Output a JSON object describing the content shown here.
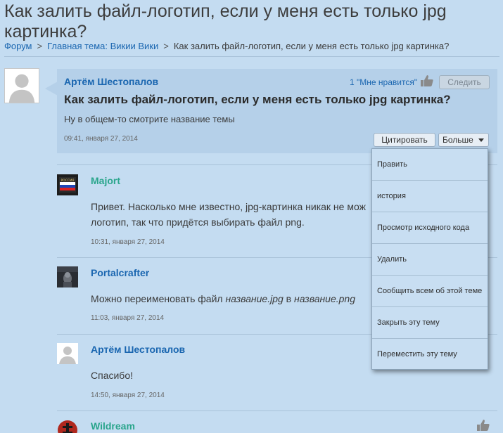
{
  "page": {
    "title": "Как залить файл-логотип, если у меня есть только jpg картинка?"
  },
  "breadcrumb": {
    "items": [
      "Форум",
      "Главная тема: Викии Вики",
      "Как залить файл-логотип, если у меня есть только jpg картинка?"
    ],
    "separator": ">"
  },
  "op": {
    "author": "Артём Шестопалов",
    "likes": "1 \"Мне нравится\"",
    "follow_label": "Следить",
    "title": "Как залить файл-логотип, если у меня есть только jpg картинка?",
    "body": "Ну в общем-то смотрите название темы",
    "time": "09:41, января 27, 2014",
    "quote_label": "Цитировать",
    "more_label": "Больше"
  },
  "replies": [
    {
      "author": "Majort",
      "body": "Привет. Насколько мне известно, jpg-картинка никак не мож логотип, так что придётся выбирать файл png.",
      "body_line1": "Привет. Насколько мне известно, jpg-картинка никак не мож",
      "body_line2": "логотип, так что придётся выбирать файл png.",
      "time": "10:31, января 27, 2014",
      "avatar_text": "РОССИЯ"
    },
    {
      "author": "Portalcrafter",
      "body_prefix": "Можно переименовать файл ",
      "body_em1": "название.jpg",
      "body_mid": " в ",
      "body_em2": "название.png",
      "time": "11:03, января 27, 2014"
    },
    {
      "author": "Артём Шестопалов",
      "body": "Спасибо!",
      "time": "14:50, января 27, 2014"
    },
    {
      "author": "Wildream"
    }
  ],
  "dropdown": {
    "items": [
      "Править",
      "история",
      "Просмотр исходного кода",
      "Удалить",
      "Сообщить всем об этой теме",
      "Закрыть эту тему",
      "Переместить эту тему"
    ]
  },
  "colors": {
    "background": "#c4dcf1",
    "op_box": "#b5d0e9",
    "link_blue": "#1a66b0",
    "author_green": "#2aa58c",
    "dropdown_bg": "#c8def2"
  },
  "icons": {
    "like": "thumbs-up-icon",
    "caret": "chevron-down-icon",
    "avatar_placeholder": "user-placeholder-icon"
  }
}
